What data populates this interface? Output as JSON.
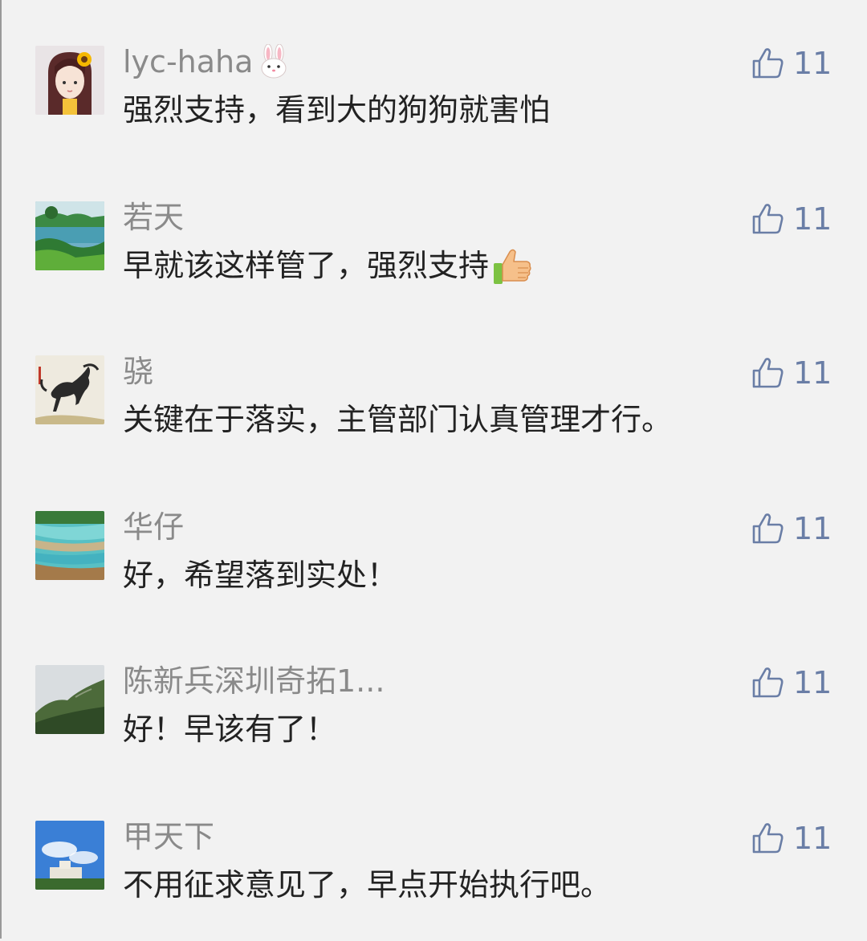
{
  "comments": [
    {
      "nickname": "lyc-haha",
      "nickname_emoji": "rabbit-face-emoji",
      "content": "强烈支持，看到大的狗狗就害怕",
      "likes": "11",
      "avatar": "girl-with-sunflower-avatar"
    },
    {
      "nickname": "若天",
      "content": "早就该这样管了，强烈支持",
      "content_emoji": "thumbs-up-emoji",
      "likes": "11",
      "avatar": "lake-landscape-avatar"
    },
    {
      "nickname": "骁",
      "content": "关键在于落实，主管部门认真管理才行。",
      "likes": "11",
      "avatar": "horse-ink-painting-avatar"
    },
    {
      "nickname": "华仔",
      "content": "好，希望落到实处！",
      "likes": "11",
      "avatar": "blue-pools-landscape-avatar"
    },
    {
      "nickname": "陈新兵深圳奇拓1...",
      "content": "好！早该有了！",
      "likes": "11",
      "avatar": "mountain-coast-avatar"
    },
    {
      "nickname": "甲天下",
      "content": "不用征求意见了，早点开始执行吧。",
      "likes": "11",
      "avatar": "blue-sky-building-avatar"
    }
  ],
  "like_icon": "thumbs-up-outline-icon",
  "colors": {
    "background": "#f2f2f2",
    "nickname": "#8a8a8a",
    "content": "#222222",
    "like": "#6a7ea6"
  }
}
